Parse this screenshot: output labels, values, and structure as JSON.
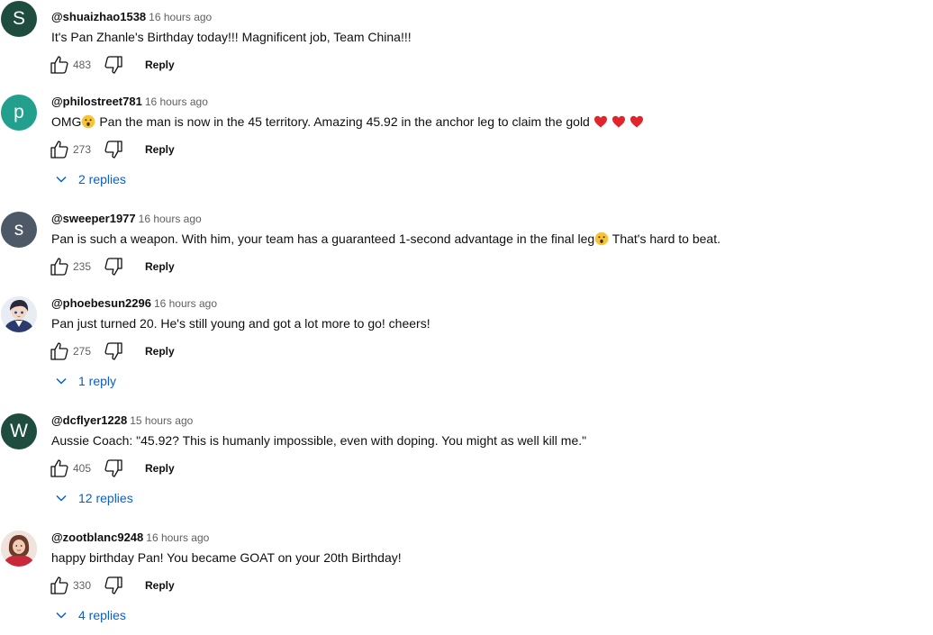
{
  "comments": [
    {
      "author": "@shuaizhao1538",
      "time": "16 hours ago",
      "text": "It's Pan Zhanle's Birthday today!!! Magnificent job, Team China!!!",
      "likes": "483",
      "reply_label": "Reply",
      "avatar": {
        "type": "letter",
        "letter": "S",
        "color": "#1e4d3f"
      },
      "replies": null
    },
    {
      "author": "@philostreet781",
      "time": "16 hours ago",
      "text_parts": [
        "OMG",
        " Pan the man is now in the 45 territory. Amazing 45.92 in the anchor leg to claim the gold "
      ],
      "likes": "273",
      "reply_label": "Reply",
      "avatar": {
        "type": "letter",
        "letter": "p",
        "color": "#22a08d"
      },
      "replies": "2 replies"
    },
    {
      "author": "@sweeper1977",
      "time": "16 hours ago",
      "text_parts": [
        "Pan is such a weapon. With him, your team has a guaranteed 1-second advantage in the final leg",
        " That's hard to beat."
      ],
      "likes": "235",
      "reply_label": "Reply",
      "avatar": {
        "type": "letter",
        "letter": "s",
        "color": "#4d5966"
      },
      "replies": null
    },
    {
      "author": "@phoebesun2296",
      "time": "16 hours ago",
      "text": "Pan just turned 20. He's still young and got a lot more to go! cheers!",
      "likes": "275",
      "reply_label": "Reply",
      "avatar": {
        "type": "image",
        "description": "anime-character-avatar"
      },
      "replies": "1 reply"
    },
    {
      "author": "@dcflyer1228",
      "time": "15 hours ago",
      "text": "Aussie Coach: \"45.92? This is humanly impossible, even with doping. You might as well kill me.\"",
      "likes": "405",
      "reply_label": "Reply",
      "avatar": {
        "type": "letter",
        "letter": "W",
        "color": "#1e4d3f"
      },
      "replies": "12 replies"
    },
    {
      "author": "@zootblanc9248",
      "time": "16 hours ago",
      "text": "happy birthday Pan! You became GOAT on your 20th Birthday!",
      "likes": "330",
      "reply_label": "Reply",
      "avatar": {
        "type": "image",
        "description": "person-photo-avatar"
      },
      "replies": "4 replies"
    }
  ],
  "icons": {
    "like": "thumbs-up-icon",
    "dislike": "thumbs-down-icon",
    "expand": "chevron-down-icon",
    "emoji_surprised": "surprised-face-emoji",
    "emoji_heart": "red-heart-emoji"
  },
  "colors": {
    "link_blue": "#065fd4",
    "meta_gray": "#606060",
    "heart_red": "#e0262c",
    "emoji_yellow": "#f7c438"
  }
}
